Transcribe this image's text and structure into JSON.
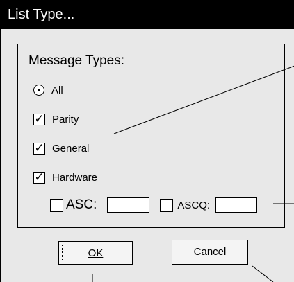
{
  "dialog": {
    "title": "List Type...",
    "group": {
      "title": "Message Types:",
      "options": [
        {
          "label": "All",
          "kind": "radio",
          "checked": true
        },
        {
          "label": "Parity",
          "kind": "checkbox",
          "checked": true,
          "mark": "✓"
        },
        {
          "label": "General",
          "kind": "checkbox",
          "checked": true,
          "mark": "✓"
        },
        {
          "label": "Hardware",
          "kind": "checkbox",
          "checked": true,
          "mark": "✓"
        }
      ],
      "asc": {
        "label": "ASC:",
        "value": "",
        "checked": false
      },
      "ascq": {
        "label": "ASCQ:",
        "value": "",
        "checked": false
      }
    },
    "buttons": {
      "ok": "OK",
      "cancel": "Cancel"
    }
  }
}
